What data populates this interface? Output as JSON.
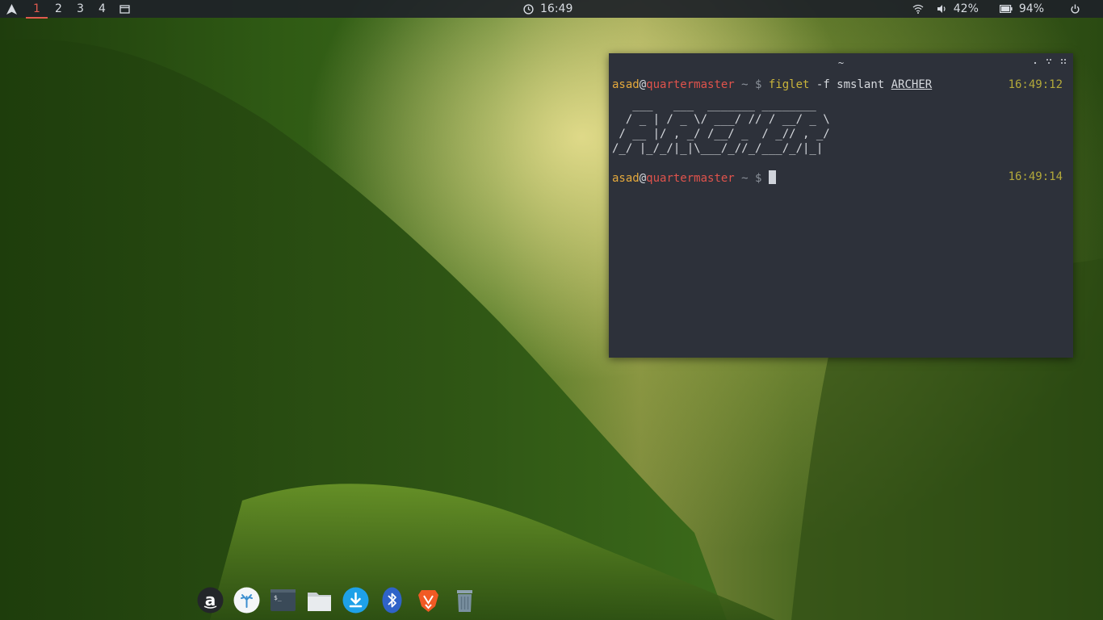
{
  "topbar": {
    "workspaces": [
      "1",
      "2",
      "3",
      "4"
    ],
    "active_workspace": "1",
    "clock": "16:49",
    "volume": "42%",
    "battery": "94%",
    "icons": [
      "arch-logo-icon",
      "window-list-icon",
      "clock-icon",
      "wifi-icon",
      "volume-icon",
      "battery-icon",
      "power-icon"
    ]
  },
  "terminal": {
    "title": "~",
    "prompt_user": "asad",
    "prompt_at": "@",
    "prompt_host": "quartermaster",
    "prompt_tilde": " ~ ",
    "prompt_dollar": "$ ",
    "cmd_name": "figlet",
    "cmd_args": " -f smslant ",
    "cmd_arg_underlined": "ARCHER",
    "timestamp_1": "16:49:12",
    "figlet_lines": [
      "   ___   ___  _______ ________",
      "  / _ | / _ \\/ ___/ // / __/ _ \\",
      " / __ |/ , _/ /__/ _  / _// , _/",
      "/_/ |_/_/|_|\\___/_//_/___/_/|_|"
    ],
    "timestamp_2": "16:49:14"
  },
  "dock": {
    "items": [
      "amazon-icon",
      "app-store-icon",
      "terminal-icon",
      "files-icon",
      "downloads-icon",
      "bluetooth-icon",
      "brave-icon",
      "trash-icon"
    ]
  },
  "colors": {
    "topbar_bg": "#1e2228",
    "active_ws": "#e05a4f",
    "terminal_bg": "#2d313a",
    "prompt_user": "#e5a93c",
    "prompt_host": "#e0534c",
    "timestamp": "#b3a93a"
  }
}
